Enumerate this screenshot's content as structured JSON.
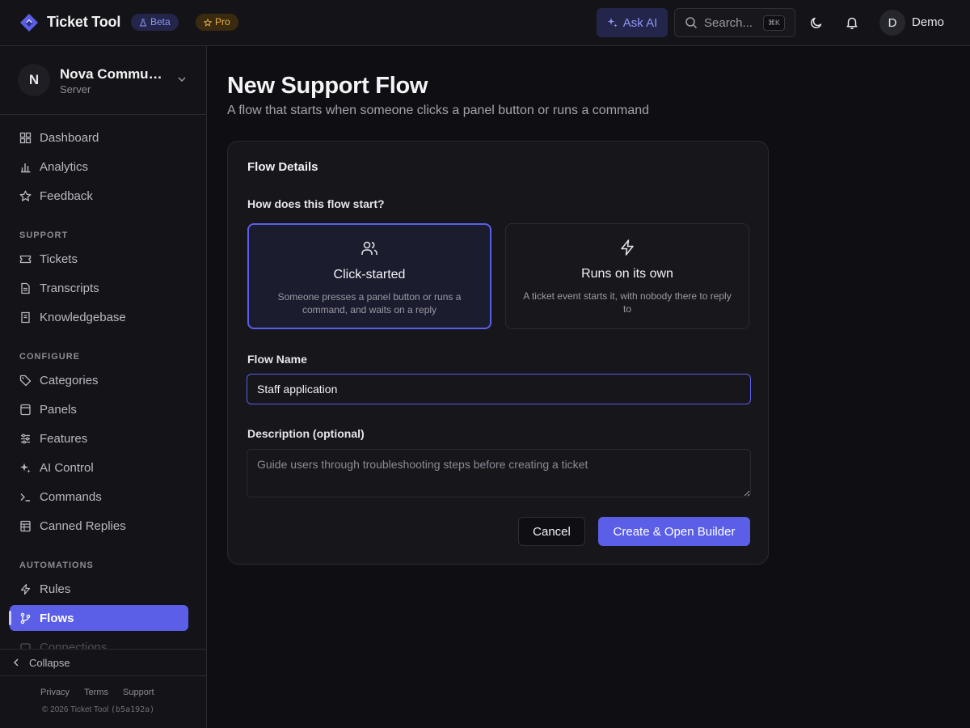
{
  "header": {
    "app_name": "Ticket Tool",
    "beta_label": "Beta",
    "pro_label": "Pro",
    "ask_ai_label": "Ask AI",
    "search_placeholder": "Search...",
    "search_shortcut": "⌘K",
    "user_initial": "D",
    "user_name": "Demo"
  },
  "sidebar": {
    "server_initial": "N",
    "server_name": "Nova Community",
    "server_sub": "Server",
    "items": [
      {
        "label": "Dashboard",
        "icon": "dashboard-icon"
      },
      {
        "label": "Analytics",
        "icon": "bar-chart-icon"
      },
      {
        "label": "Feedback",
        "icon": "star-icon"
      }
    ],
    "sections": [
      {
        "label": "SUPPORT",
        "items": [
          {
            "label": "Tickets",
            "icon": "ticket-icon"
          },
          {
            "label": "Transcripts",
            "icon": "file-text-icon"
          },
          {
            "label": "Knowledgebase",
            "icon": "book-icon"
          }
        ]
      },
      {
        "label": "CONFIGURE",
        "items": [
          {
            "label": "Categories",
            "icon": "tag-icon"
          },
          {
            "label": "Panels",
            "icon": "panel-icon"
          },
          {
            "label": "Features",
            "icon": "sliders-icon"
          },
          {
            "label": "AI Control",
            "icon": "sparkles-icon"
          },
          {
            "label": "Commands",
            "icon": "terminal-icon"
          },
          {
            "label": "Canned Replies",
            "icon": "list-icon"
          }
        ]
      },
      {
        "label": "AUTOMATIONS",
        "items": [
          {
            "label": "Rules",
            "icon": "zap-icon"
          },
          {
            "label": "Flows",
            "icon": "git-branch-icon",
            "active": true
          },
          {
            "label": "Connections",
            "icon": "link-icon"
          }
        ]
      }
    ],
    "collapse_label": "Collapse",
    "footer_links": [
      "Privacy",
      "Terms",
      "Support"
    ],
    "copyright": "© 2026 Ticket Tool",
    "build_hash": "(b5a192a)"
  },
  "main": {
    "title": "New Support Flow",
    "subtitle": "A flow that starts when someone clicks a panel button or runs a command",
    "card_title": "Flow Details",
    "start_question": "How does this flow start?",
    "options": [
      {
        "title": "Click-started",
        "desc": "Someone presses a panel button or runs a command, and waits on a reply",
        "icon": "users-icon",
        "selected": true
      },
      {
        "title": "Runs on its own",
        "desc": "A ticket event starts it, with nobody there to reply to",
        "icon": "zap-icon",
        "selected": false
      }
    ],
    "flow_name_label": "Flow Name",
    "flow_name_value": "Staff application",
    "description_label": "Description (optional)",
    "description_placeholder": "Guide users through troubleshooting steps before creating a ticket",
    "cancel_label": "Cancel",
    "submit_label": "Create & Open Builder"
  },
  "colors": {
    "accent": "#5b5fe8",
    "background": "#0f0f13",
    "panel": "#141418",
    "beta_text": "#8e95f4",
    "pro_text": "#e8b04a"
  }
}
